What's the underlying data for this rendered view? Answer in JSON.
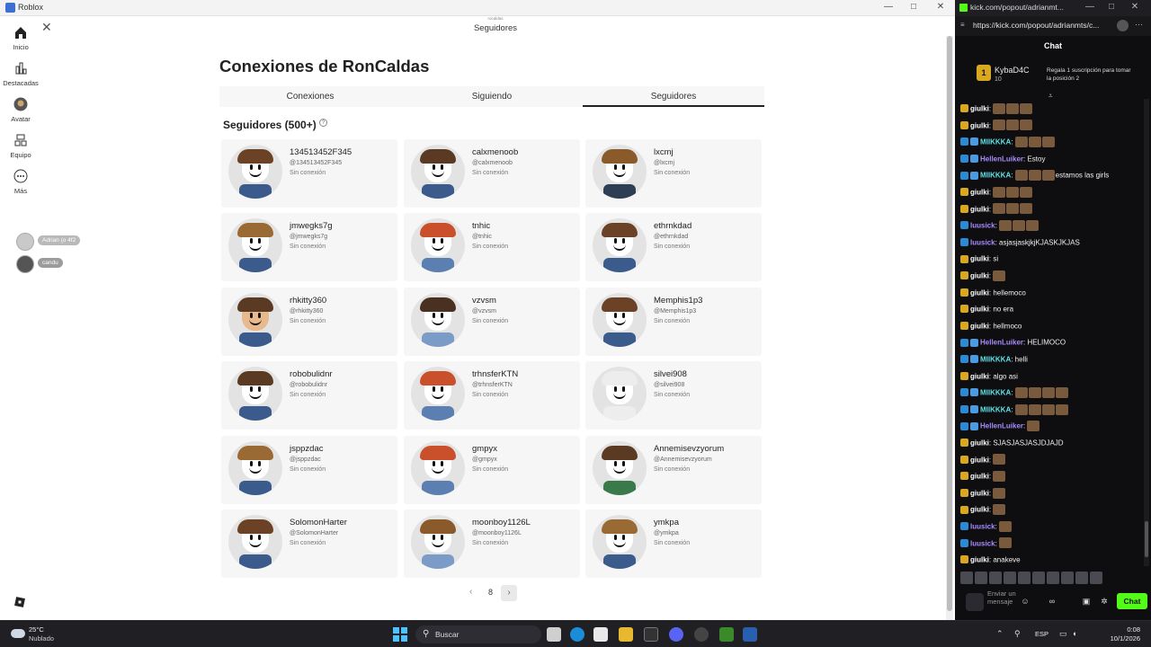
{
  "roblox": {
    "window_title": "Roblox",
    "header_sub": "rocaldas",
    "header_title": "Seguidores",
    "sidebar": [
      {
        "label": "Inicio",
        "icon": "home-icon"
      },
      {
        "label": "Destacadas",
        "icon": "charts-icon"
      },
      {
        "label": "Avatar",
        "icon": "avatar-icon"
      },
      {
        "label": "Equipo",
        "icon": "team-icon"
      },
      {
        "label": "Más",
        "icon": "more-icon"
      }
    ],
    "online_friends": [
      {
        "name": "Adrian (o 4f2"
      },
      {
        "name": "candu"
      }
    ],
    "page_title": "Conexiones de RonCaldas",
    "tabs": [
      {
        "label": "Conexiones",
        "active": false
      },
      {
        "label": "Siguiendo",
        "active": false
      },
      {
        "label": "Seguidores",
        "active": true
      }
    ],
    "section_title": "Seguidores (500+)",
    "help_glyph": "?",
    "followers": [
      {
        "name": "134513452F345",
        "handle": "@134513452F345",
        "status": "Sin conexión",
        "hair": "#6b4226",
        "skin": "#ffffff",
        "shirt": "#3b5b8c"
      },
      {
        "name": "calxmenoob",
        "handle": "@calxmenoob",
        "status": "Sin conexión",
        "hair": "#5a3a22",
        "skin": "#ffffff",
        "shirt": "#3b5b8c"
      },
      {
        "name": "lxcmj",
        "handle": "@lxcmj",
        "status": "Sin conexión",
        "hair": "#8b5a2b",
        "skin": "#ffffff",
        "shirt": "#2d3e55"
      },
      {
        "name": "jmwegks7g",
        "handle": "@jmwegks7g",
        "status": "Sin conexión",
        "hair": "#9a6a34",
        "skin": "#ffffff",
        "shirt": "#3b5b8c"
      },
      {
        "name": "tnhic",
        "handle": "@tnhic",
        "status": "Sin conexión",
        "hair": "#c9502a",
        "skin": "#ffffff",
        "shirt": "#5b7fb0"
      },
      {
        "name": "ethrnkdad",
        "handle": "@ethrnkdad",
        "status": "Sin conexión",
        "hair": "#6b4226",
        "skin": "#ffffff",
        "shirt": "#3b5b8c"
      },
      {
        "name": "rhkitty360",
        "handle": "@rhkitty360",
        "status": "Sin conexión",
        "hair": "#5a3a22",
        "skin": "#e8b98c",
        "shirt": "#3b5b8c"
      },
      {
        "name": "vzvsm",
        "handle": "@vzvsm",
        "status": "Sin conexión",
        "hair": "#4a3020",
        "skin": "#ffffff",
        "shirt": "#7a9cc6"
      },
      {
        "name": "Memphis1p3",
        "handle": "@Memphis1p3",
        "status": "Sin conexión",
        "hair": "#6b4226",
        "skin": "#ffffff",
        "shirt": "#3b5b8c"
      },
      {
        "name": "robobulidnr",
        "handle": "@robobulidnr",
        "status": "Sin conexión",
        "hair": "#5a3a22",
        "skin": "#ffffff",
        "shirt": "#3b5b8c"
      },
      {
        "name": "trhnsferKTN",
        "handle": "@trhnsferKTN",
        "status": "Sin conexión",
        "hair": "#c9502a",
        "skin": "#ffffff",
        "shirt": "#5b7fb0"
      },
      {
        "name": "silvei908",
        "handle": "@silvei908",
        "status": "Sin conexión",
        "hair": "#ededed",
        "skin": "#ffffff",
        "shirt": "#ededed"
      },
      {
        "name": "jsppzdac",
        "handle": "@jsppzdac",
        "status": "Sin conexión",
        "hair": "#9a6a34",
        "skin": "#ffffff",
        "shirt": "#3b5b8c"
      },
      {
        "name": "gmpyx",
        "handle": "@gmpyx",
        "status": "Sin conexión",
        "hair": "#c9502a",
        "skin": "#ffffff",
        "shirt": "#5b7fb0"
      },
      {
        "name": "Annemisevzyorum",
        "handle": "@Annemisevzyorum",
        "status": "Sin conexión",
        "hair": "#5a3a22",
        "skin": "#ffffff",
        "shirt": "#3a7a4a"
      },
      {
        "name": "SolomonHarter",
        "handle": "@SolomonHarter",
        "status": "Sin conexión",
        "hair": "#6b4226",
        "skin": "#ffffff",
        "shirt": "#3b5b8c"
      },
      {
        "name": "moonboy1126L",
        "handle": "@moonboy1126L",
        "status": "Sin conexión",
        "hair": "#8b5a2b",
        "skin": "#ffffff",
        "shirt": "#7a9cc6"
      },
      {
        "name": "ymkpa",
        "handle": "@ymkpa",
        "status": "Sin conexión",
        "hair": "#9a6a34",
        "skin": "#ffffff",
        "shirt": "#3b5b8c"
      }
    ],
    "pagination": {
      "prev": "‹",
      "page": "8",
      "next": "›"
    }
  },
  "kick": {
    "window_title": "kick.com/popout/adrianmt...",
    "url": "https://kick.com/popout/adrianmts/c...",
    "chat_title": "Chat",
    "pinned": {
      "rank": "1",
      "name": "KybaD4C",
      "count": "10",
      "gift_text": "Regala 1 suscripción para tomar la posición 2"
    },
    "messages": [
      {
        "user": "giulki",
        "color": "#ffffff",
        "badges": [
          "crown"
        ],
        "text": "",
        "emotes": 3
      },
      {
        "user": "giulki",
        "color": "#ffffff",
        "badges": [
          "crown"
        ],
        "text": "",
        "emotes": 3
      },
      {
        "user": "MIIKKKA",
        "color": "#5ce1e6",
        "badges": [
          "sub",
          "og"
        ],
        "text": "",
        "emotes": 3
      },
      {
        "user": "HellenLuiker",
        "color": "#a88cff",
        "badges": [
          "sub",
          "og"
        ],
        "text": "Estoy",
        "emotes": 0
      },
      {
        "user": "MIIKKKA",
        "color": "#5ce1e6",
        "badges": [
          "sub",
          "og"
        ],
        "text": "estamos las girls",
        "emotes": 3
      },
      {
        "user": "giulki",
        "color": "#ffffff",
        "badges": [
          "crown"
        ],
        "text": "",
        "emotes": 3
      },
      {
        "user": "giulki",
        "color": "#ffffff",
        "badges": [
          "crown"
        ],
        "text": "",
        "emotes": 3
      },
      {
        "user": "luusick",
        "color": "#a88cff",
        "badges": [
          "sub"
        ],
        "text": "",
        "emotes": 3
      },
      {
        "user": "luusick",
        "color": "#a88cff",
        "badges": [
          "sub"
        ],
        "text": "asjasjaskjkjKJASKJKJAS",
        "emotes": 0
      },
      {
        "user": "giulki",
        "color": "#ffffff",
        "badges": [
          "crown"
        ],
        "text": "si",
        "emotes": 0
      },
      {
        "user": "giulki",
        "color": "#ffffff",
        "badges": [
          "crown"
        ],
        "text": "",
        "emotes": 1
      },
      {
        "user": "giulki",
        "color": "#ffffff",
        "badges": [
          "crown"
        ],
        "text": "hellemoco",
        "emotes": 0
      },
      {
        "user": "giulki",
        "color": "#ffffff",
        "badges": [
          "crown"
        ],
        "text": "no era",
        "emotes": 0
      },
      {
        "user": "giulki",
        "color": "#ffffff",
        "badges": [
          "crown"
        ],
        "text": "hellmoco",
        "emotes": 0
      },
      {
        "user": "HellenLuiker",
        "color": "#a88cff",
        "badges": [
          "sub",
          "og"
        ],
        "text": "HELIMOCO",
        "emotes": 0
      },
      {
        "user": "MIIKKKA",
        "color": "#5ce1e6",
        "badges": [
          "sub",
          "og"
        ],
        "text": "helli",
        "emotes": 0
      },
      {
        "user": "giulki",
        "color": "#ffffff",
        "badges": [
          "crown"
        ],
        "text": "algo asi",
        "emotes": 0
      },
      {
        "user": "MIIKKKA",
        "color": "#5ce1e6",
        "badges": [
          "sub",
          "og"
        ],
        "text": "",
        "emotes": 4
      },
      {
        "user": "MIIKKKA",
        "color": "#5ce1e6",
        "badges": [
          "sub",
          "og"
        ],
        "text": "",
        "emotes": 4
      },
      {
        "user": "HellenLuiker",
        "color": "#a88cff",
        "badges": [
          "sub",
          "og"
        ],
        "text": "",
        "emotes": 1
      },
      {
        "user": "giulki",
        "color": "#ffffff",
        "badges": [
          "crown"
        ],
        "text": "SJASJASJASJDJAJD",
        "emotes": 0
      },
      {
        "user": "giulki",
        "color": "#ffffff",
        "badges": [
          "crown"
        ],
        "text": "",
        "emotes": 1
      },
      {
        "user": "giulki",
        "color": "#ffffff",
        "badges": [
          "crown"
        ],
        "text": "",
        "emotes": 1
      },
      {
        "user": "giulki",
        "color": "#ffffff",
        "badges": [
          "crown"
        ],
        "text": "",
        "emotes": 1
      },
      {
        "user": "giulki",
        "color": "#ffffff",
        "badges": [
          "crown"
        ],
        "text": "",
        "emotes": 1
      },
      {
        "user": "luusick",
        "color": "#a88cff",
        "badges": [
          "sub"
        ],
        "text": "",
        "emotes": 1
      },
      {
        "user": "luusick",
        "color": "#a88cff",
        "badges": [
          "sub"
        ],
        "text": "",
        "emotes": 1
      },
      {
        "user": "giulki",
        "color": "#ffffff",
        "badges": [
          "crown"
        ],
        "text": "anakeve",
        "emotes": 0
      }
    ],
    "input_placeholder": "Enviar un mensaje",
    "send_label": "Chat",
    "accent": "#53fc18"
  },
  "taskbar": {
    "temp": "25°C",
    "condition": "Nublado",
    "search_label": "Buscar",
    "lang": "ESP",
    "time": "0:08",
    "date": "10/1/2026"
  }
}
